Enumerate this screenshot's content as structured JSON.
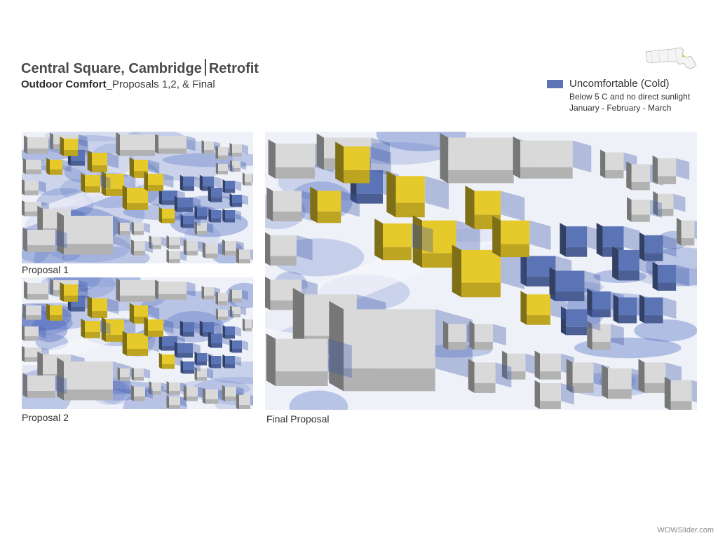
{
  "header": {
    "title_main": "Central Square, Cambridge",
    "title_suffix": "Retrofit",
    "subtitle_strong": "Outdoor Comfort",
    "subtitle_rest": "_Proposals 1,2, & Final"
  },
  "legend": {
    "label": "Uncomfortable (Cold)",
    "line1": "Below 5 C and no direct sunlight",
    "line2": "January - February - March",
    "swatch_color": "#5b74b6"
  },
  "colors": {
    "cold": "#5b74b6",
    "proposed": "#e6c92a",
    "existing": "#d9d9d9",
    "ground": "#eef1f8"
  },
  "panels": [
    {
      "caption": "Proposal 1"
    },
    {
      "caption": "Proposal 2"
    },
    {
      "caption": "Final Proposal"
    }
  ],
  "watermark": "WOWSlider.com"
}
